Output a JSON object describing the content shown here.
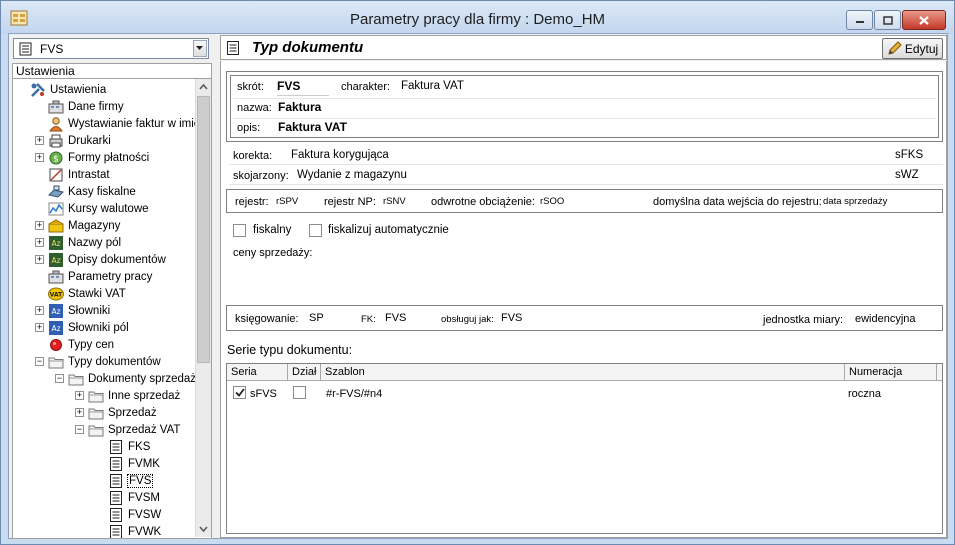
{
  "window": {
    "title": "Parametry pracy dla firmy : Demo_HM"
  },
  "colors": {
    "titlebar": "#c9dbf0",
    "close_button": "#c4392a",
    "selection": "#000000"
  },
  "left_panel": {
    "combo_value": "FVS",
    "tree_header": "Ustawienia",
    "tree": [
      {
        "label": "Ustawienia",
        "icon": "tools-icon",
        "level": 0,
        "expander": "none"
      },
      {
        "label": "Dane firmy",
        "icon": "company-icon",
        "level": 1,
        "expander": "none"
      },
      {
        "label": "Wystawianie faktur w imieniu",
        "icon": "person-icon",
        "level": 1,
        "expander": "none"
      },
      {
        "label": "Drukarki",
        "icon": "printer-icon",
        "level": 1,
        "expander": "plus"
      },
      {
        "label": "Formy płatności",
        "icon": "payment-icon",
        "level": 1,
        "expander": "plus"
      },
      {
        "label": "Intrastat",
        "icon": "intrastat-icon",
        "level": 1,
        "expander": "none"
      },
      {
        "label": "Kasy fiskalne",
        "icon": "register-icon",
        "level": 1,
        "expander": "none"
      },
      {
        "label": "Kursy walutowe",
        "icon": "chart-icon",
        "level": 1,
        "expander": "none"
      },
      {
        "label": "Magazyny",
        "icon": "warehouse-icon",
        "level": 1,
        "expander": "plus"
      },
      {
        "label": "Nazwy pól",
        "icon": "az-icon",
        "level": 1,
        "expander": "plus"
      },
      {
        "label": "Opisy dokumentów",
        "icon": "az-icon",
        "level": 1,
        "expander": "plus"
      },
      {
        "label": "Parametry pracy",
        "icon": "company-icon",
        "level": 1,
        "expander": "none"
      },
      {
        "label": "Stawki VAT",
        "icon": "vat-icon",
        "level": 1,
        "expander": "none"
      },
      {
        "label": "Słowniki",
        "icon": "dictionary-icon",
        "level": 1,
        "expander": "plus"
      },
      {
        "label": "Słowniki pól",
        "icon": "dictionary-icon",
        "level": 1,
        "expander": "plus"
      },
      {
        "label": "Typy cen",
        "icon": "red-dot-icon",
        "level": 1,
        "expander": "none"
      },
      {
        "label": "Typy dokumentów",
        "icon": "folder-icon",
        "level": 1,
        "expander": "minus"
      },
      {
        "label": "Dokumenty sprzedaży",
        "icon": "folder-icon",
        "level": 2,
        "expander": "minus"
      },
      {
        "label": "Inne sprzedaż",
        "icon": "folder-icon",
        "level": 3,
        "expander": "plus"
      },
      {
        "label": "Sprzedaż",
        "icon": "folder-icon",
        "level": 3,
        "expander": "plus"
      },
      {
        "label": "Sprzedaż VAT",
        "icon": "folder-icon",
        "level": 3,
        "expander": "minus"
      },
      {
        "label": "FKS",
        "icon": "doc-icon",
        "level": 4,
        "expander": "none"
      },
      {
        "label": "FVMK",
        "icon": "doc-icon",
        "level": 4,
        "expander": "none"
      },
      {
        "label": "FVS",
        "icon": "doc-icon",
        "level": 4,
        "expander": "none",
        "selected": true
      },
      {
        "label": "FVSM",
        "icon": "doc-icon",
        "level": 4,
        "expander": "none"
      },
      {
        "label": "FVSW",
        "icon": "doc-icon",
        "level": 4,
        "expander": "none"
      },
      {
        "label": "FVWK",
        "icon": "doc-icon",
        "level": 4,
        "expander": "none"
      }
    ]
  },
  "right_panel": {
    "title": "Typ dokumentu",
    "edit_label": "Edytuj",
    "skrot_label": "skrót:",
    "skrot_value": "FVS",
    "charakter_label": "charakter:",
    "charakter_value": "Faktura VAT",
    "nazwa_label": "nazwa:",
    "nazwa_value": "Faktura",
    "opis_label": "opis:",
    "opis_value": "Faktura VAT",
    "korekta_label": "korekta:",
    "korekta_value": "Faktura korygująca",
    "korekta_code": "sFKS",
    "skojarzony_label": "skojarzony:",
    "skojarzony_value": "Wydanie z magazynu",
    "skojarzony_code": "sWZ",
    "rejestr_label": "rejestr:",
    "rejestr_value": "rSPV",
    "rejestr_np_label": "rejestr NP:",
    "rejestr_np_value": "rSNV",
    "odwrotne_label": "odwrotne obciążenie:",
    "odwrotne_value": "rSOO",
    "domyslna_label": "domyślna data wejścia do rejestru:",
    "domyslna_value": "data sprzedaży",
    "fiskalny_label": "fiskalny",
    "fiskalny_checked": false,
    "fiskalizuj_label": "fiskalizuj automatycznie",
    "fiskalizuj_checked": false,
    "ceny_label": "ceny sprzedaży:",
    "ksiegowanie_label": "księgowanie:",
    "ksiegowanie_value": "SP",
    "fk_label": "FK:",
    "fk_value": "FVS",
    "obsluguj_label": "obsługuj jak:",
    "obsluguj_value": "FVS",
    "jednostka_label": "jednostka miary:",
    "jednostka_value": "ewidencyjna",
    "series_title": "Serie typu dokumentu:",
    "series_columns": [
      "Seria",
      "Dział",
      "Szablon",
      "Numeracja"
    ],
    "series_rows": [
      {
        "seria": "sFVS",
        "seria_checked": true,
        "dzial_checked": false,
        "szablon": "#r-FVS/#n4",
        "numeracja": "roczna"
      }
    ]
  }
}
